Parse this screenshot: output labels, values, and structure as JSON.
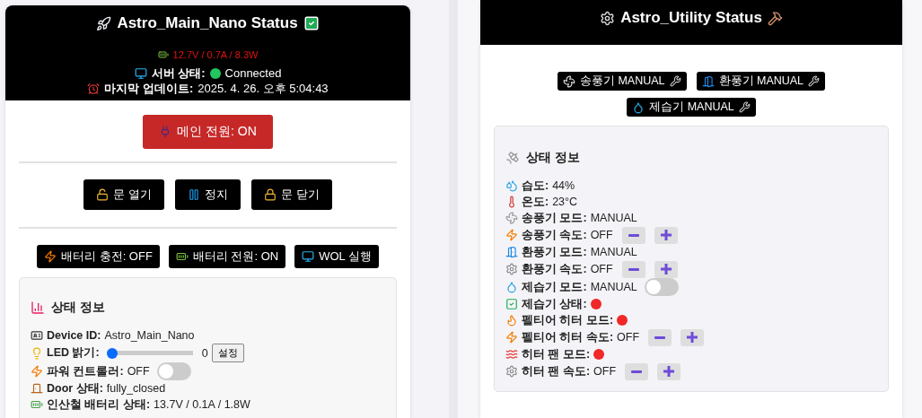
{
  "main": {
    "title": "Astro_Main_Nano Status",
    "power_reading": "12.7V / 0.7A / 8.3W",
    "server": {
      "label": "서버 상태:",
      "value": "Connected",
      "connected": true
    },
    "update": {
      "label": "마지막 업데이트:",
      "value": "2025. 4. 26. 오후 5:04:43"
    },
    "main_power_button": {
      "label": "메인 전원: ON",
      "on": true
    },
    "door_buttons": [
      "문 열기",
      "정지",
      "문 닫기"
    ],
    "power_buttons": [
      "배터리 충전: OFF",
      "배터리 전원: ON",
      "WOL 실행"
    ],
    "status": {
      "title": "상태 정보",
      "rows": [
        {
          "kind": "text",
          "label": "Device ID:",
          "value": "Astro_Main_Nano"
        },
        {
          "kind": "slider",
          "label": "LED 밝기:",
          "level": 0,
          "value": "0",
          "button": "설정"
        },
        {
          "kind": "toggle",
          "label": "파워 컨트롤러:",
          "value": "OFF",
          "on": false
        },
        {
          "kind": "text",
          "label": "Door 상태:",
          "value": "fully_closed"
        },
        {
          "kind": "text",
          "label": "인산철 배터리 상태:",
          "value": "13.7V / 0.1A / 1.8W"
        }
      ]
    }
  },
  "utility": {
    "title": "Astro_Utility Status",
    "mode_badges": [
      "송풍기 MANUAL",
      "환풍기 MANUAL",
      "제습기 MANUAL"
    ],
    "status": {
      "title": "상태 정보",
      "rows": [
        {
          "kind": "text",
          "label": "습도:",
          "value": "44%"
        },
        {
          "kind": "text",
          "label": "온도:",
          "value": "23°C"
        },
        {
          "kind": "text",
          "label": "송풍기 모드:",
          "value": "MANUAL"
        },
        {
          "kind": "speed",
          "label": "송풍기 속도:",
          "value": "OFF"
        },
        {
          "kind": "text",
          "label": "환풍기 모드:",
          "value": "MANUAL"
        },
        {
          "kind": "speed",
          "label": "환풍기 속도:",
          "value": "OFF"
        },
        {
          "kind": "toggle",
          "label": "제습기 모드:",
          "value": "MANUAL",
          "on": false
        },
        {
          "kind": "dot",
          "label": "제습기 상태:",
          "on": false
        },
        {
          "kind": "dot",
          "label": "펠티어 히터 모드:",
          "on": false
        },
        {
          "kind": "speed",
          "label": "펠티어 히터 속도:",
          "value": "OFF"
        },
        {
          "kind": "dot",
          "label": "히터 팬 모드:",
          "on": false
        },
        {
          "kind": "speed",
          "label": "히터 팬 속도:",
          "value": "OFF"
        }
      ]
    }
  }
}
